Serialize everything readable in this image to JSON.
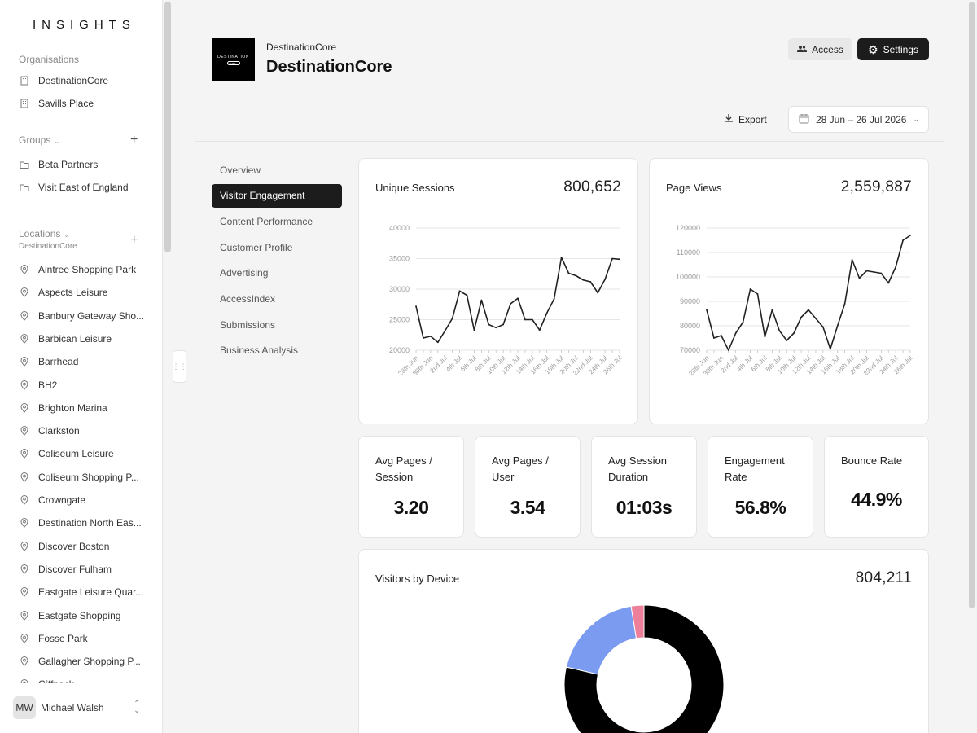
{
  "app": {
    "logo_text": "INSIGHTS"
  },
  "sidebar": {
    "organisations_label": "Organisations",
    "organisations": [
      "DestinationCore",
      "Savills Place"
    ],
    "groups_label": "Groups",
    "groups": [
      "Beta Partners",
      "Visit East of England"
    ],
    "locations_label": "Locations",
    "locations_sub": "DestinationCore",
    "locations": [
      "Aintree Shopping Park",
      "Aspects Leisure",
      "Banbury Gateway Sho...",
      "Barbican Leisure",
      "Barrhead",
      "BH2",
      "Brighton Marina",
      "Clarkston",
      "Coliseum Leisure",
      "Coliseum Shopping P...",
      "Crowngate",
      "Destination North Eas...",
      "Discover Boston",
      "Discover Fulham",
      "Eastgate Leisure Quar...",
      "Eastgate Shopping",
      "Fosse Park",
      "Gallagher Shopping P...",
      "Giffnock"
    ],
    "user": {
      "initials": "MW",
      "name": "Michael Walsh"
    }
  },
  "header": {
    "org_logo_text": "DESTINATION",
    "org_logo_sub": "CORE",
    "org_small": "DestinationCore",
    "org_title": "DestinationCore",
    "access_label": "Access",
    "settings_label": "Settings",
    "export_label": "Export",
    "date_range": "28 Jun – 26 Jul 2026"
  },
  "subnav": {
    "items": [
      "Overview",
      "Visitor Engagement",
      "Content Performance",
      "Customer Profile",
      "Advertising",
      "AccessIndex",
      "Submissions",
      "Business Analysis"
    ],
    "active": "Visitor Engagement"
  },
  "cards": {
    "unique_sessions": {
      "title": "Unique Sessions",
      "value": "800,652"
    },
    "page_views": {
      "title": "Page Views",
      "value": "2,559,887"
    },
    "visitors_by_device": {
      "title": "Visitors by Device",
      "value": "804,211"
    }
  },
  "stats": [
    {
      "label_line1": "Avg Pages /",
      "label_line2": "Session",
      "value": "3.20"
    },
    {
      "label_line1": "Avg Pages /",
      "label_line2": "User",
      "value": "3.54"
    },
    {
      "label_line1": "Avg Session",
      "label_line2": "Duration",
      "value": "01:03s"
    },
    {
      "label_line1": "Engagement",
      "label_line2": "Rate",
      "value": "56.8%"
    },
    {
      "label_line1": "Bounce Rate",
      "label_line2": "",
      "value": "44.9%"
    }
  ],
  "chart_data": [
    {
      "type": "line",
      "title": "Unique Sessions",
      "x": [
        "28th Jun",
        "29th Jun",
        "30th Jun",
        "1st Jul",
        "2nd Jul",
        "3rd Jul",
        "4th Jul",
        "5th Jul",
        "6th Jul",
        "7th Jul",
        "8th Jul",
        "9th Jul",
        "10th Jul",
        "11th Jul",
        "12th Jul",
        "13th Jul",
        "14th Jul",
        "15th Jul",
        "16th Jul",
        "17th Jul",
        "18th Jul",
        "19th Jul",
        "20th Jul",
        "21st Jul",
        "22nd Jul",
        "23rd Jul",
        "24th Jul",
        "25th Jul",
        "26th Jul"
      ],
      "x_tick_labels": [
        "28th Jun",
        "30th Jun",
        "2nd Jul",
        "4th Jul",
        "6th Jul",
        "8th Jul",
        "10th Jul",
        "12th Jul",
        "14th Jul",
        "16th Jul",
        "18th Jul",
        "20th Jul",
        "22nd Jul",
        "24th Jul",
        "26th Jul"
      ],
      "values": [
        27200,
        22000,
        22300,
        21300,
        23200,
        25200,
        29700,
        29000,
        23300,
        28200,
        24200,
        23700,
        24200,
        27600,
        28500,
        25000,
        25000,
        23300,
        26100,
        28400,
        35200,
        32600,
        32200,
        31500,
        31200,
        29400,
        31600,
        35000,
        34900
      ],
      "y_ticks": [
        20000,
        25000,
        30000,
        35000,
        40000
      ],
      "ylim": [
        20000,
        40000
      ],
      "grid": true,
      "color": "#222222"
    },
    {
      "type": "line",
      "title": "Page Views",
      "x": [
        "28th Jun",
        "29th Jun",
        "30th Jun",
        "1st Jul",
        "2nd Jul",
        "3rd Jul",
        "4th Jul",
        "5th Jul",
        "6th Jul",
        "7th Jul",
        "8th Jul",
        "9th Jul",
        "10th Jul",
        "11th Jul",
        "12th Jul",
        "13th Jul",
        "14th Jul",
        "15th Jul",
        "16th Jul",
        "17th Jul",
        "18th Jul",
        "19th Jul",
        "20th Jul",
        "21st Jul",
        "22nd Jul",
        "23rd Jul",
        "24th Jul",
        "25th Jul",
        "26th Jul"
      ],
      "x_tick_labels": [
        "28th Jun",
        "30th Jun",
        "2nd Jul",
        "4th Jul",
        "6th Jul",
        "8th Jul",
        "10th Jul",
        "12th Jul",
        "14th Jul",
        "16th Jul",
        "18th Jul",
        "20th Jul",
        "22nd Jul",
        "24th Jul",
        "26th Jul"
      ],
      "values": [
        86500,
        75000,
        76000,
        70000,
        77000,
        81500,
        95000,
        93000,
        75500,
        86500,
        78000,
        74000,
        77000,
        83500,
        86500,
        83000,
        79500,
        70500,
        80000,
        89000,
        107000,
        99500,
        102500,
        102000,
        101500,
        97500,
        104000,
        115000,
        117000
      ],
      "y_ticks": [
        70000,
        80000,
        90000,
        100000,
        110000,
        120000
      ],
      "ylim": [
        70000,
        120000
      ],
      "grid": true,
      "color": "#222222"
    },
    {
      "type": "pie",
      "title": "Visitors by Device",
      "labels": [
        "",
        "",
        ""
      ],
      "values": [
        78.6,
        18.8,
        2.6
      ],
      "display_labels": [
        "78.6%",
        "18.8%",
        ""
      ],
      "colors": [
        "#000000",
        "#7b9bf0",
        "#ee7f9a"
      ]
    }
  ]
}
